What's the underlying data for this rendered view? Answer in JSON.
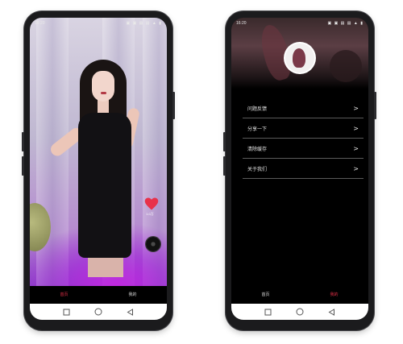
{
  "status_bar": {
    "time": "16:20",
    "left_icons": "● ●",
    "right_icons": "▣ ▣ ▤ ▤ ▲ ▮"
  },
  "left_screen": {
    "like_count": "1.0万",
    "tabs": [
      {
        "label": "首页",
        "active": true
      },
      {
        "label": "我的",
        "active": false
      }
    ]
  },
  "right_screen": {
    "menu": [
      {
        "label": "问题反馈",
        "arrow": ">"
      },
      {
        "label": "分享一下",
        "arrow": ">"
      },
      {
        "label": "清除缓存",
        "arrow": ">"
      },
      {
        "label": "关于我们",
        "arrow": ">"
      }
    ],
    "tabs": [
      {
        "label": "首页",
        "active": false
      },
      {
        "label": "我的",
        "active": true
      }
    ]
  },
  "colors": {
    "accent": "#e8314a",
    "heart": "#e8314a"
  },
  "icons": {
    "nav_recent": "square-icon",
    "nav_home": "circle-icon",
    "nav_back": "triangle-back-icon"
  }
}
